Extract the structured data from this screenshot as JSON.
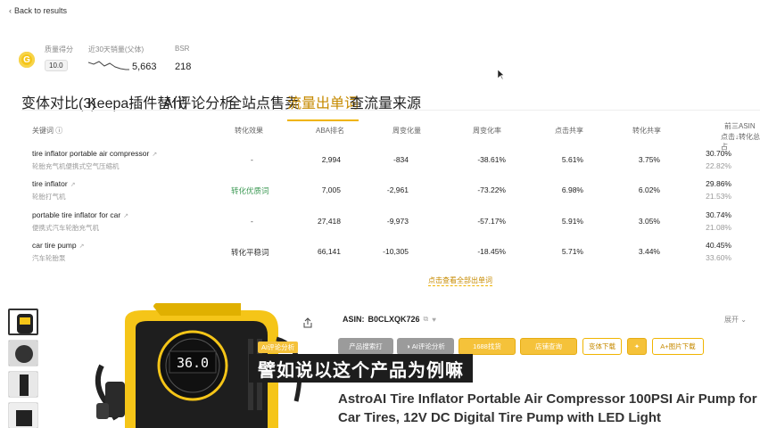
{
  "back": {
    "label": "Back to results"
  },
  "stats": {
    "score_label": "质量得分",
    "score_value": "10.0",
    "sales_label": "近30天销量(父体)",
    "sales_value": "5,663",
    "bsr_label": "BSR",
    "bsr_value": "218"
  },
  "tabs": [
    {
      "label": "变体对比(3)"
    },
    {
      "label": "Keepa插件替代"
    },
    {
      "label": "AI评论分析"
    },
    {
      "label": "全站点售卖"
    },
    {
      "label": "流量出单词"
    },
    {
      "label": "查流量来源"
    }
  ],
  "active_tab": "流量出单词",
  "table": {
    "headers": {
      "keyword": "关键词 ⓘ",
      "effect": "转化效果",
      "aba": "ABA排名",
      "weekly_change": "周变化量",
      "weekly_rate": "周变化率",
      "click_share": "点击共享",
      "conv_share": "转化共享",
      "top3_line1": "前三ASIN",
      "top3_line2": "点击↓转化总占"
    },
    "rows": [
      {
        "keyword": "tire inflator portable air compressor",
        "keyword_cn": "轮胎充气机便携式空气压缩机",
        "effect": "-",
        "aba": "2,994",
        "change": "-834",
        "rate": "-38.61%",
        "click": "5.61%",
        "conv": "3.75%",
        "top_a": "30.70%",
        "top_b": "22.82%"
      },
      {
        "keyword": "tire inflator",
        "keyword_cn": "轮胎打气机",
        "effect": "转化优质词",
        "aba": "7,005",
        "change": "-2,961",
        "rate": "-73.22%",
        "click": "6.98%",
        "conv": "6.02%",
        "top_a": "29.86%",
        "top_b": "21.53%"
      },
      {
        "keyword": "portable tire inflator for car",
        "keyword_cn": "便携式汽车轮胎充气机",
        "effect": "-",
        "aba": "27,418",
        "change": "-9,973",
        "rate": "-57.17%",
        "click": "5.91%",
        "conv": "3.05%",
        "top_a": "30.74%",
        "top_b": "21.08%"
      },
      {
        "keyword": "car tire pump",
        "keyword_cn": "汽车轮胎泵",
        "effect": "转化平稳词",
        "aba": "66,141",
        "change": "-10,305",
        "rate": "-18.45%",
        "click": "5.71%",
        "conv": "3.44%",
        "top_a": "40.45%",
        "top_b": "33.60%"
      }
    ],
    "more_link": "点击查看全部出单词"
  },
  "product": {
    "asin_label": "ASIN:",
    "asin_value": "B0CLXQK726",
    "expand_label": "展开",
    "buttons": {
      "b1": "产品搜索打",
      "b2": "AI评论分析",
      "b3": "1688找货",
      "b4": "店铺查询",
      "b5": "变体下载",
      "b6": "A+图片下载",
      "overlay": "AI评论分析"
    },
    "display_reading": "36.0",
    "subtitle": "譬如说以这个产品为例嘛",
    "title": "AstroAI Tire Inflator Portable Air Compressor 100PSI Air Pump for Car Tires, 12V DC Digital Tire Pump with LED Light"
  },
  "colors": {
    "accent": "#f0b400",
    "green": "#3f9a56",
    "product_yellow": "#f5c518"
  }
}
